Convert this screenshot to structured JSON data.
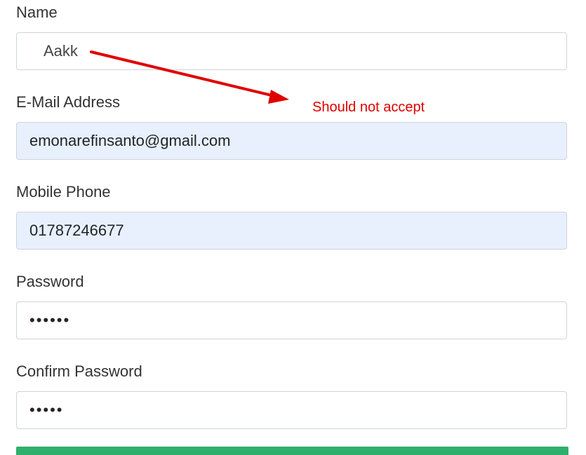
{
  "form": {
    "name": {
      "label": "Name",
      "value": "Aakk"
    },
    "email": {
      "label": "E-Mail Address",
      "value": "emonarefinsanto@gmail.com"
    },
    "phone": {
      "label": "Mobile Phone",
      "value": "01787246677"
    },
    "password": {
      "label": "Password",
      "value": "••••••"
    },
    "confirm_password": {
      "label": "Confirm Password",
      "value": "•••••"
    }
  },
  "annotation": {
    "text": "Should not accept",
    "color": "#e00000"
  },
  "colors": {
    "autofill_bg": "#e8f0fe",
    "submit_button": "#2eaf6b"
  }
}
